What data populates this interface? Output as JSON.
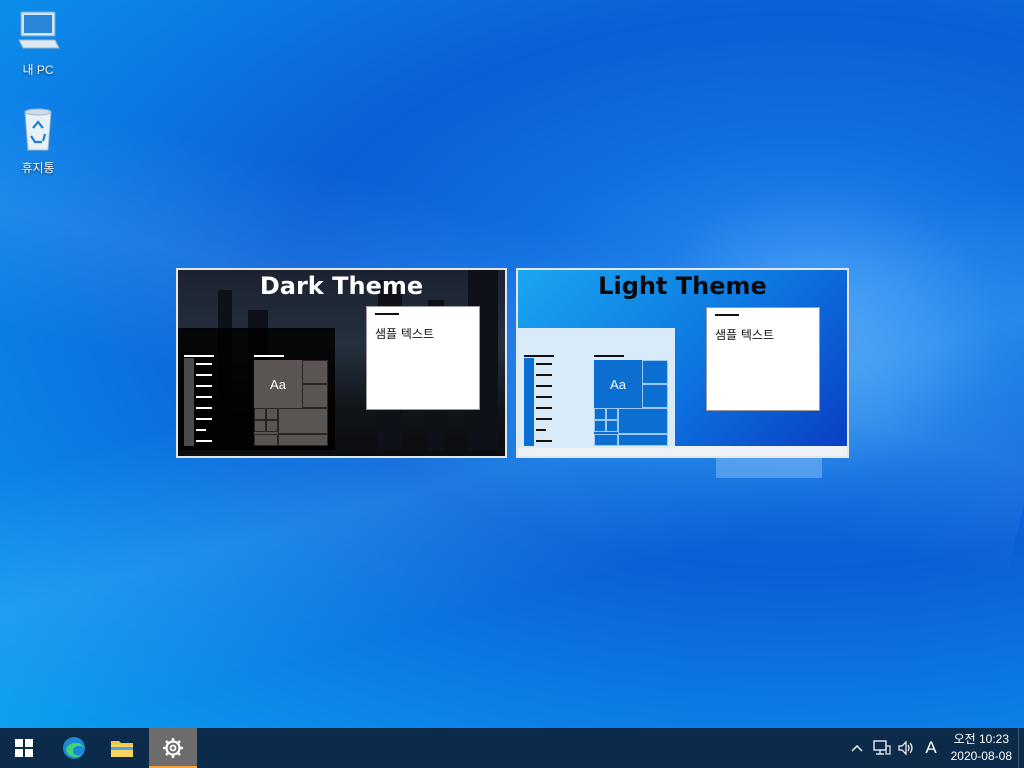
{
  "desktop": {
    "icons": [
      {
        "label": "내 PC",
        "icon": "computer-icon"
      },
      {
        "label": "휴지통",
        "icon": "recycle-bin-icon"
      }
    ]
  },
  "themes": [
    {
      "title": "Dark Theme",
      "sample_text": "샘플 텍스트",
      "tile_text": "Aa"
    },
    {
      "title": "Light Theme",
      "sample_text": "샘플 텍스트",
      "tile_text": "Aa"
    }
  ],
  "taskbar": {
    "buttons": [
      {
        "name": "start",
        "icon": "windows-logo-icon"
      },
      {
        "name": "edge",
        "icon": "edge-icon"
      },
      {
        "name": "file-explorer",
        "icon": "folder-icon"
      },
      {
        "name": "settings",
        "icon": "gear-icon",
        "active": true
      }
    ],
    "tray": {
      "input_indicator": "A",
      "icons": [
        "chevron-up-icon",
        "network-icon",
        "volume-icon"
      ]
    },
    "clock": {
      "time": "오전 10:23",
      "date": "2020-08-08"
    }
  },
  "colors": {
    "taskbar": "#0c2a4a",
    "active_button": "#6d6b6b",
    "active_indicator": "#f7a23a",
    "accent": "#0a6fd0"
  }
}
